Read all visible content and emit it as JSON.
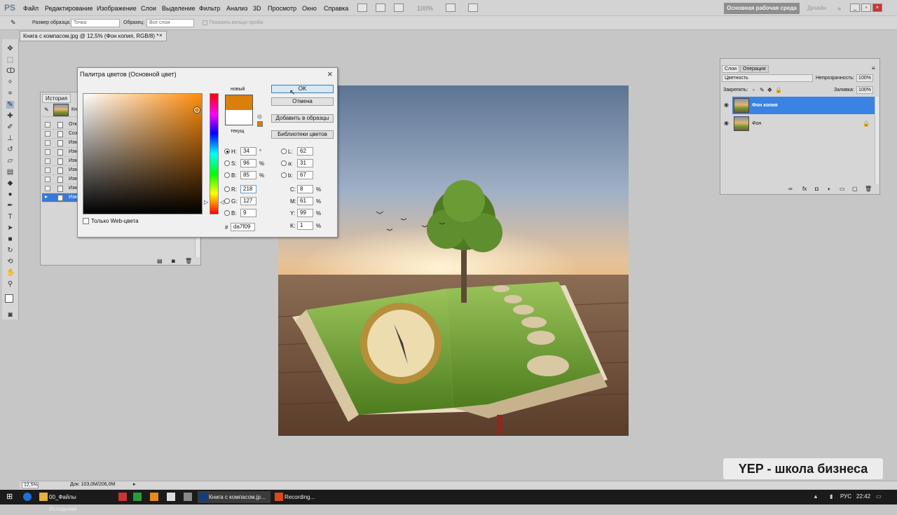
{
  "app": {
    "logo": "PS"
  },
  "menu": [
    "Файл",
    "Редактирование",
    "Изображение",
    "Слои",
    "Выделение",
    "Фильтр",
    "Анализ",
    "3D",
    "Просмотр",
    "Окно",
    "Справка"
  ],
  "menubar_right": {
    "zoom": "100%",
    "workspace": "Основная рабочая среда",
    "design": "Дизайн"
  },
  "options": {
    "sample_size_label": "Размер образца:",
    "sample_size_value": "Точка",
    "sample_label": "Образец:",
    "sample_value": "Все слои",
    "ring_label": "Показать кольцо пробы"
  },
  "document_tab": "Книга с компасом.jpg @ 12,5% (Фон копия, RGB/8) *",
  "history": {
    "title": "История",
    "rows": [
      "Кни",
      "Отк",
      "Соз",
      "Изм",
      "Изм",
      "Изм",
      "Изм",
      "Изм",
      "Изм",
      "Изм"
    ]
  },
  "dialog": {
    "title": "Палитра цветов (Основной цвет)",
    "new_label": "новый",
    "current_label": "текущ",
    "ok": "OK",
    "cancel": "Отмена",
    "add_swatch": "Добавить в образцы",
    "libraries": "Библиотеки цветов",
    "fields": {
      "H": {
        "label": "H:",
        "value": "34",
        "unit": "°"
      },
      "S": {
        "label": "S:",
        "value": "96",
        "unit": "%"
      },
      "B": {
        "label": "B:",
        "value": "85",
        "unit": "%"
      },
      "R": {
        "label": "R:",
        "value": "218"
      },
      "G": {
        "label": "G:",
        "value": "127"
      },
      "Bl": {
        "label": "B:",
        "value": "9"
      },
      "L": {
        "label": "L:",
        "value": "62"
      },
      "a": {
        "label": "a:",
        "value": "31"
      },
      "b": {
        "label": "b:",
        "value": "67"
      },
      "C": {
        "label": "C:",
        "value": "8",
        "unit": "%"
      },
      "M": {
        "label": "M:",
        "value": "61",
        "unit": "%"
      },
      "Y": {
        "label": "Y:",
        "value": "99",
        "unit": "%"
      },
      "K": {
        "label": "K:",
        "value": "1",
        "unit": "%"
      }
    },
    "hex_label": "#",
    "hex": "da7f09",
    "web_only": "Только Web-цвета",
    "colors": {
      "new": "#da7f09",
      "current": "#ffffff"
    }
  },
  "layers": {
    "tabs": [
      "Слои",
      "Операция"
    ],
    "blend_mode": "Цветность",
    "opacity_label": "Непрозрачность:",
    "opacity": "100%",
    "lock_label": "Закрепить:",
    "fill_label": "Заливка:",
    "fill": "100%",
    "items": [
      {
        "name": "Фон копия",
        "selected": true
      },
      {
        "name": "Фон",
        "selected": false
      }
    ]
  },
  "status": {
    "zoom": "12,5%",
    "doc": "Док: 103,0M/206,0M"
  },
  "taskbar": {
    "items": [
      "00_Файлы Исходники",
      "Книга с компасом.jp...",
      "Recording..."
    ],
    "lang": "РУС",
    "time": "22:42"
  },
  "watermark": "YEP - школа бизнеса"
}
